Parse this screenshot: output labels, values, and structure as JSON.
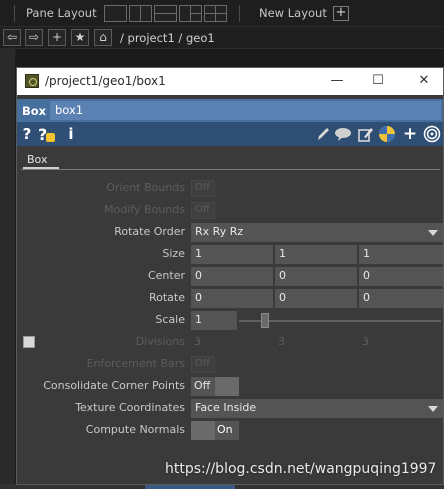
{
  "topbar": {
    "pane_layout_label": "Pane Layout",
    "new_layout_label": "New Layout",
    "new_layout_add": "+"
  },
  "pathbar": {
    "back": "⇦",
    "forward": "⇨",
    "add": "+",
    "favorite": "★",
    "home": "⌂",
    "path": "/ project1 / geo1"
  },
  "window": {
    "title": "/project1/geo1/box1",
    "minimize": "—",
    "maximize": "☐",
    "close": "✕",
    "op_type": "Box",
    "op_name": "box1",
    "tab": "Box",
    "params": {
      "orient_bounds": {
        "label": "Orient Bounds",
        "value": "Off"
      },
      "modify_bounds": {
        "label": "Modify Bounds",
        "value": "Off"
      },
      "rotate_order": {
        "label": "Rotate Order",
        "value": "Rx Ry Rz"
      },
      "size": {
        "label": "Size",
        "values": [
          "1",
          "1",
          "1"
        ]
      },
      "center": {
        "label": "Center",
        "values": [
          "0",
          "0",
          "0"
        ]
      },
      "rotate": {
        "label": "Rotate",
        "values": [
          "0",
          "0",
          "0"
        ]
      },
      "scale": {
        "label": "Scale",
        "value": "1"
      },
      "divisions": {
        "label": "Divisions",
        "values": [
          "3",
          "3",
          "3"
        ]
      },
      "enforcement_bars": {
        "label": "Enforcement Bars",
        "value": "Off"
      },
      "consolidate_corner_points": {
        "label": "Consolidate Corner Points",
        "value": "Off"
      },
      "texture_coordinates": {
        "label": "Texture Coordinates",
        "value": "Face Inside"
      },
      "compute_normals": {
        "label": "Compute Normals",
        "value": "On"
      }
    }
  },
  "watermark": "https://blog.csdn.net/wangpuqing1997",
  "colors": {
    "op_bar": "#476f9e",
    "icon_bar": "#2f4e74",
    "panel": "#3a3a3a",
    "field": "#545454"
  }
}
